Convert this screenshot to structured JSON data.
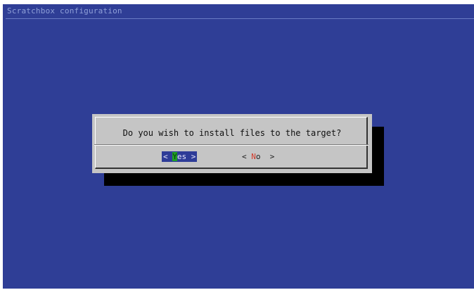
{
  "app": {
    "backtitle": "Scratchbox configuration"
  },
  "dialog": {
    "question": "Do you wish to install files to the target?",
    "buttons": {
      "yes": {
        "left_bracket": "< ",
        "hotkey": "Y",
        "rest": "es",
        "right_bracket": " >",
        "selected": true
      },
      "no": {
        "left_bracket": "< ",
        "hotkey": "N",
        "rest": "o",
        "right_bracket": "  >",
        "selected": false
      }
    }
  },
  "colors": {
    "background": "#2f3e96",
    "dialog": "#c5c5c5",
    "shadow": "#000000",
    "selected_button": "#2e3c98",
    "hotkey_selected": "#1fa024",
    "hotkey_unselected": "#d23a2a"
  }
}
